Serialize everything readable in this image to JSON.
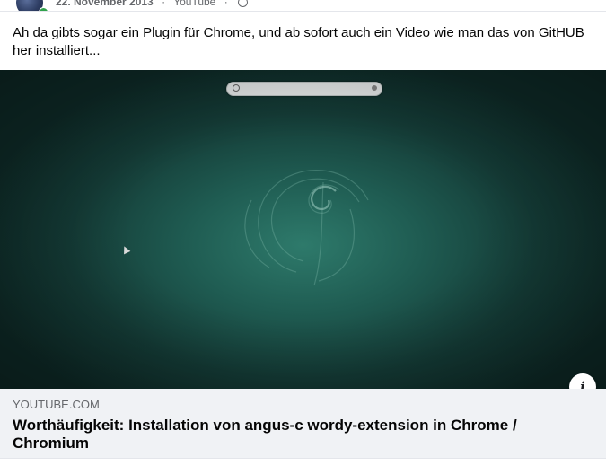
{
  "header": {
    "date": "22. November 2013",
    "source": "YouTube",
    "separator": "·"
  },
  "post": {
    "text": "Ah da gibts sogar ein Plugin für Chrome, und ab sofort auch ein Video wie man das von GitHUB her installiert..."
  },
  "link_card": {
    "domain": "YOUTUBE.COM",
    "title": "Worthäufigkeit: Installation von angus-c wordy-extension in Chrome / Chromium"
  },
  "video": {
    "info_label": "i"
  }
}
